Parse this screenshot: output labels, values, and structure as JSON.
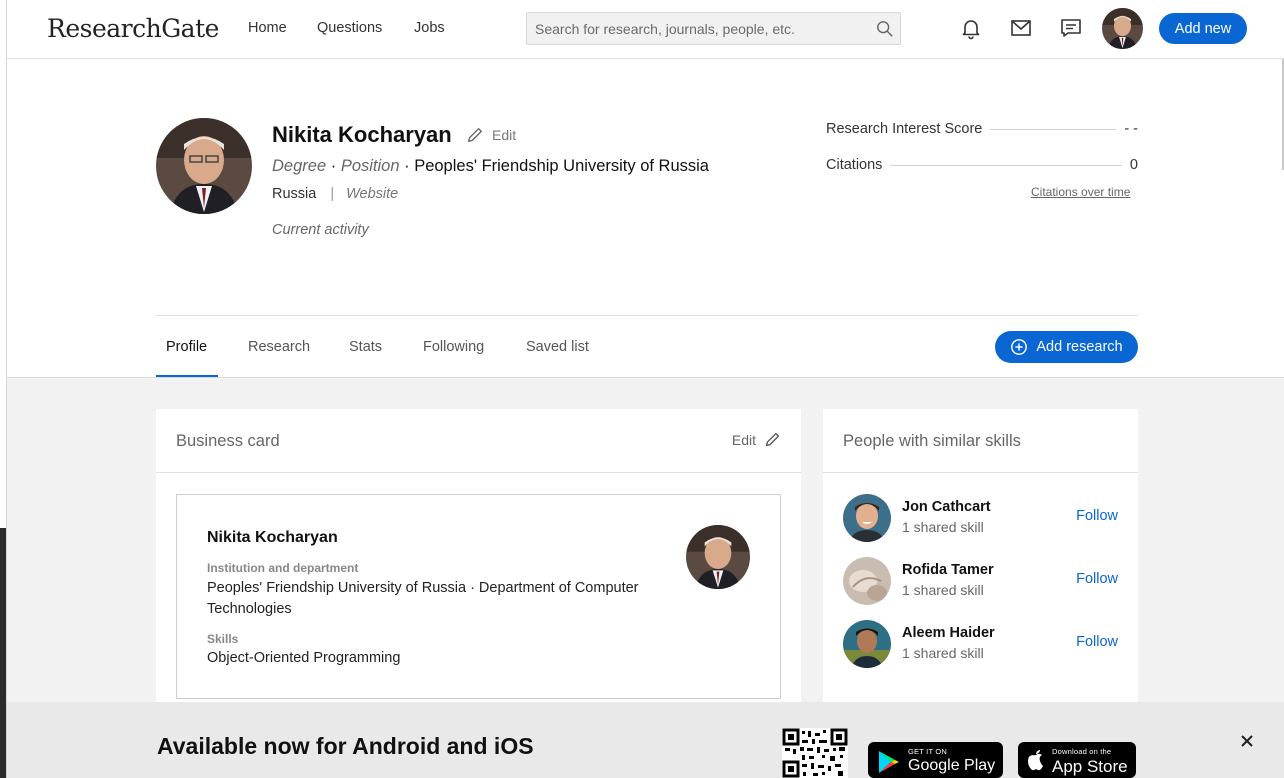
{
  "brand": {
    "logo_text": "ResearchGate"
  },
  "nav": {
    "links": [
      "Home",
      "Questions",
      "Jobs"
    ],
    "search_placeholder": "Search for research, journals, people, etc.",
    "add_new_label": "Add new"
  },
  "profile": {
    "name": "Nikita Kocharyan",
    "edit_label": "Edit",
    "degree": "Degree",
    "position": "Position",
    "institution": "Peoples' Friendship University of Russia",
    "country": "Russia",
    "website": "Website",
    "current_activity": "Current activity",
    "dot": "·",
    "bar": "|"
  },
  "stats": {
    "research_interest_label": "Research Interest Score",
    "research_interest_value": "- -",
    "citations_label": "Citations",
    "citations_value": "0",
    "citations_link": "Citations over time"
  },
  "tabs": [
    "Profile",
    "Research",
    "Stats",
    "Following",
    "Saved list"
  ],
  "add_research_label": "Add research",
  "business_card": {
    "title": "Business card",
    "edit_label": "Edit",
    "name": "Nikita Kocharyan",
    "institution_label": "Institution and department",
    "institution_value": "Peoples' Friendship University of Russia · Department of Computer Technologies",
    "skills_label": "Skills",
    "skills_value": "Object-Oriented Programming"
  },
  "similar": {
    "title": "People with similar skills",
    "people": [
      {
        "name": "Jon Cathcart",
        "sub": "1 shared skill",
        "action": "Follow"
      },
      {
        "name": "Rofida Tamer",
        "sub": "1 shared skill",
        "action": "Follow"
      },
      {
        "name": "Aleem Haider",
        "sub": "1 shared skill",
        "action": "Follow"
      }
    ]
  },
  "banner": {
    "title": "Available now for Android and iOS",
    "google_small": "GET IT ON",
    "google_big": "Google Play",
    "apple_small": "Download on the",
    "apple_big": "App Store"
  },
  "colors": {
    "accent": "#0a66d3",
    "banner_bg": "#e9e9e9",
    "page_grey": "#f2f2f2"
  }
}
